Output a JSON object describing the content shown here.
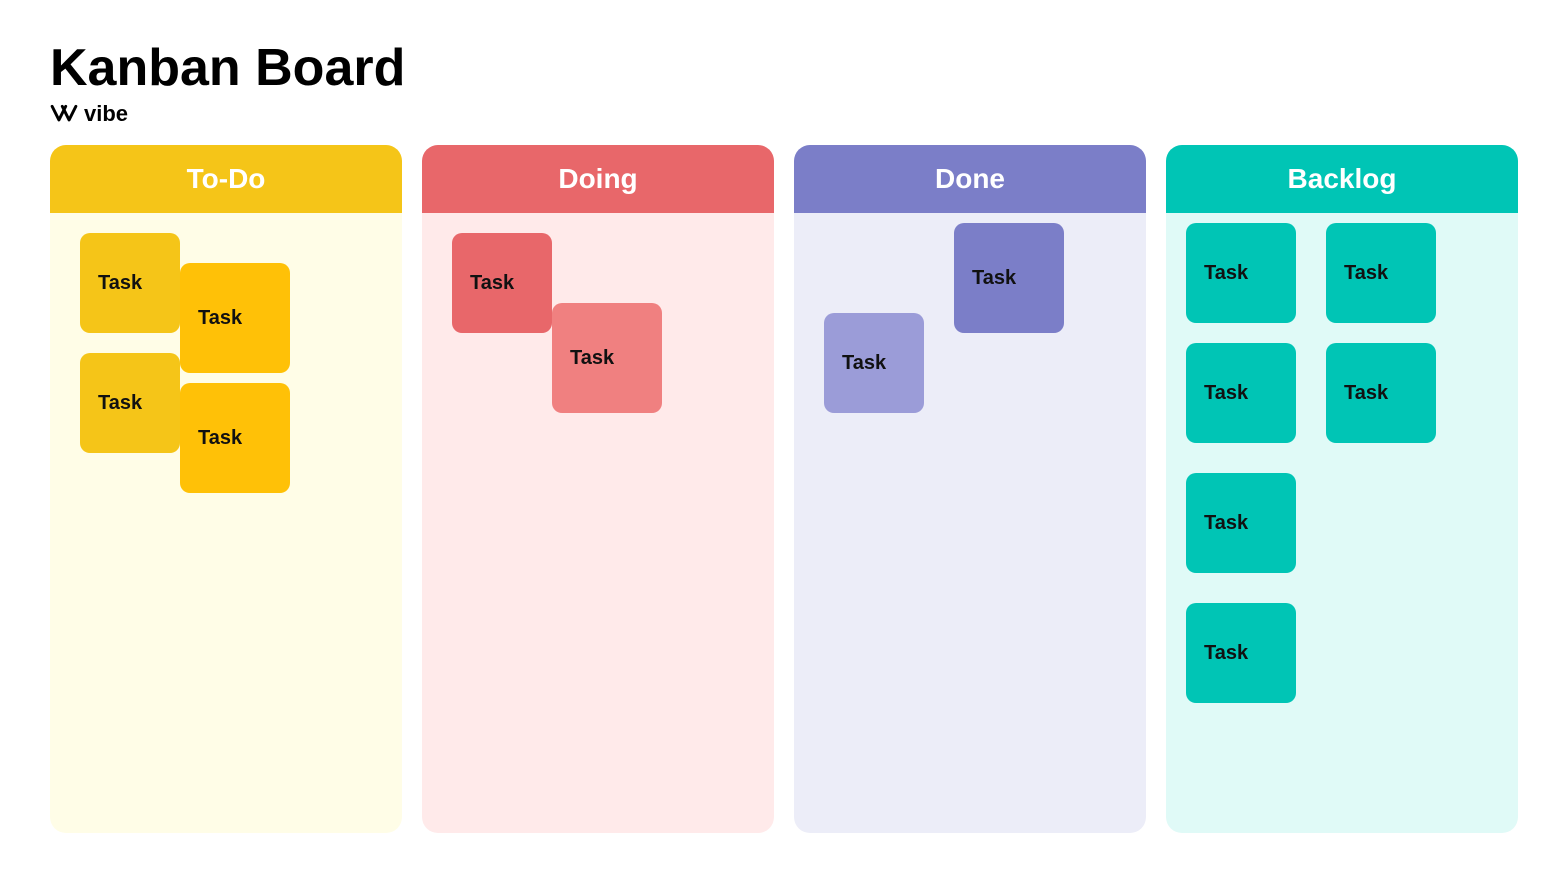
{
  "header": {
    "title": "Kanban Board",
    "brand": "vibe"
  },
  "columns": [
    {
      "id": "todo",
      "label": "To-Do",
      "headerColor": "#F5C518",
      "bodyColor": "#FFFDE7",
      "tasks": [
        {
          "label": "Task",
          "size": "small",
          "position": "todo-t1",
          "colorClass": "task-todo"
        },
        {
          "label": "Task",
          "size": "medium",
          "position": "todo-t2",
          "colorClass": "task-todo-light"
        },
        {
          "label": "Task",
          "size": "small",
          "position": "todo-t3",
          "colorClass": "task-todo"
        },
        {
          "label": "Task",
          "size": "medium",
          "position": "todo-t4",
          "colorClass": "task-todo-light"
        }
      ]
    },
    {
      "id": "doing",
      "label": "Doing",
      "headerColor": "#E8676A",
      "bodyColor": "#FFEAEA",
      "tasks": [
        {
          "label": "Task",
          "position": "doing-t1",
          "colorClass": "task-doing"
        },
        {
          "label": "Task",
          "position": "doing-t2",
          "colorClass": "task-doing-light"
        }
      ]
    },
    {
      "id": "done",
      "label": "Done",
      "headerColor": "#7B7EC8",
      "bodyColor": "#ECEDF8",
      "tasks": [
        {
          "label": "Task",
          "position": "done-t1",
          "colorClass": "task-done-light"
        },
        {
          "label": "Task",
          "position": "done-t2",
          "colorClass": "task-done-blue"
        }
      ]
    },
    {
      "id": "backlog",
      "label": "Backlog",
      "headerColor": "#00C5B5",
      "bodyColor": "#E0FAF7",
      "tasks": [
        {
          "label": "Task",
          "position": "backlog-t1",
          "colorClass": "task-backlog"
        },
        {
          "label": "Task",
          "position": "backlog-t2",
          "colorClass": "task-backlog"
        },
        {
          "label": "Task",
          "position": "backlog-t3",
          "colorClass": "task-backlog"
        },
        {
          "label": "Task",
          "position": "backlog-t4",
          "colorClass": "task-backlog"
        },
        {
          "label": "Task",
          "position": "backlog-t5",
          "colorClass": "task-backlog"
        },
        {
          "label": "Task",
          "position": "backlog-t6",
          "colorClass": "task-backlog"
        }
      ]
    }
  ]
}
